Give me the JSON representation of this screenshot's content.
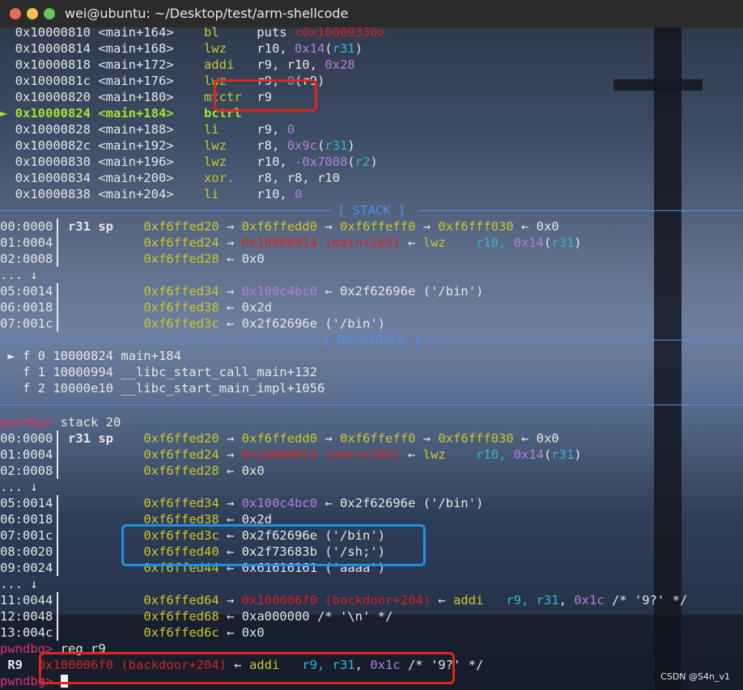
{
  "window": {
    "title": "wei@ubuntu: ~/Desktop/test/arm-shellcode"
  },
  "disasm": [
    {
      "addr": "0x10000810",
      "sym": "<main+164>",
      "op": "bl",
      "args": [
        [
          "puts ",
          "white"
        ],
        [
          "<0x10009330>",
          "red"
        ]
      ]
    },
    {
      "addr": "0x10000814",
      "sym": "<main+168>",
      "op": "lwz",
      "args": [
        [
          "r10, ",
          "white"
        ],
        [
          "0x14",
          "purple"
        ],
        [
          "(",
          "white"
        ],
        [
          "r31",
          "cyan"
        ],
        [
          ")",
          "white"
        ]
      ]
    },
    {
      "addr": "0x10000818",
      "sym": "<main+172>",
      "op": "addi",
      "args": [
        [
          "r9, r10, ",
          "white"
        ],
        [
          "0x28",
          "purple"
        ]
      ]
    },
    {
      "addr": "0x1000081c",
      "sym": "<main+176>",
      "op": "lwz",
      "args": [
        [
          "r9, ",
          "white"
        ],
        [
          "0",
          "purple"
        ],
        [
          "(r9)",
          "white"
        ]
      ]
    },
    {
      "addr": "0x10000820",
      "sym": "<main+180>",
      "op": "mtctr",
      "args": [
        [
          "r9",
          "white"
        ]
      ]
    },
    {
      "addr": "0x10000824",
      "sym": "<main+184>",
      "op": "bctrl",
      "args": [],
      "current": true
    },
    {
      "addr": "0x10000828",
      "sym": "<main+188>",
      "op": "li",
      "args": [
        [
          "r9, ",
          "white"
        ],
        [
          "0",
          "purple"
        ]
      ]
    },
    {
      "addr": "0x1000082c",
      "sym": "<main+192>",
      "op": "lwz",
      "args": [
        [
          "r8, ",
          "white"
        ],
        [
          "0x9c",
          "purple"
        ],
        [
          "(",
          "white"
        ],
        [
          "r31",
          "cyan"
        ],
        [
          ")",
          "white"
        ]
      ]
    },
    {
      "addr": "0x10000830",
      "sym": "<main+196>",
      "op": "lwz",
      "args": [
        [
          "r10, ",
          "white"
        ],
        [
          "-0x7008",
          "purple"
        ],
        [
          "(",
          "white"
        ],
        [
          "r2",
          "cyan"
        ],
        [
          ")",
          "white"
        ]
      ]
    },
    {
      "addr": "0x10000834",
      "sym": "<main+200>",
      "op": "xor.",
      "args": [
        [
          "r8, r8, r10",
          "white"
        ]
      ]
    },
    {
      "addr": "0x10000838",
      "sym": "<main+204>",
      "op": "li",
      "args": [
        [
          "r10, ",
          "white"
        ],
        [
          "0",
          "purple"
        ]
      ]
    }
  ],
  "current_marker": "►",
  "sections": {
    "stack": "[ STACK ]",
    "backtrace": "[ BACKTRACE ]"
  },
  "stack1": [
    {
      "off": "00:0000",
      "reg": "r31 sp",
      "parts": [
        [
          "0xf6ffed20",
          "yellow"
        ],
        [
          " → ",
          "white"
        ],
        [
          "0xf6ffedd0",
          "yellow"
        ],
        [
          " → ",
          "white"
        ],
        [
          "0xf6ffeff0",
          "yellow"
        ],
        [
          " → ",
          "white"
        ],
        [
          "0xf6fff030",
          "yellow"
        ],
        [
          " ← 0x0",
          "white"
        ]
      ]
    },
    {
      "off": "01:0004",
      "reg": "",
      "parts": [
        [
          "0xf6ffed24",
          "yellow"
        ],
        [
          " → ",
          "white"
        ],
        [
          "0x10000814 (main+168)",
          "red"
        ],
        [
          " ← ",
          "white"
        ],
        [
          "lwz",
          "yellow"
        ],
        [
          "    r10, ",
          "cyan"
        ],
        [
          "0x14",
          "purple"
        ],
        [
          "(",
          "white"
        ],
        [
          "r31",
          "cyan"
        ],
        [
          ")",
          "white"
        ]
      ]
    },
    {
      "off": "02:0008",
      "reg": "",
      "parts": [
        [
          "0xf6ffed28",
          "yellow"
        ],
        [
          " ← 0x0",
          "white"
        ]
      ]
    },
    {
      "off": "... ↓",
      "reg": "",
      "parts": [],
      "ellipsis": true
    },
    {
      "off": "05:0014",
      "reg": "",
      "parts": [
        [
          "0xf6ffed34",
          "yellow"
        ],
        [
          " → ",
          "white"
        ],
        [
          "0x100c4bc0",
          "purple"
        ],
        [
          " ← 0x2f62696e ('/bin')",
          "white"
        ]
      ]
    },
    {
      "off": "06:0018",
      "reg": "",
      "parts": [
        [
          "0xf6ffed38",
          "yellow"
        ],
        [
          " ← 0x2d",
          "white"
        ]
      ]
    },
    {
      "off": "07:001c",
      "reg": "",
      "parts": [
        [
          "0xf6ffed3c",
          "yellow"
        ],
        [
          " ← 0x2f62696e ('/bin')",
          "white"
        ]
      ]
    }
  ],
  "backtrace": [
    {
      "marker": "►",
      "frame": "f 0 10000824 main+184"
    },
    {
      "marker": " ",
      "frame": "f 1 10000994 __libc_start_call_main+132"
    },
    {
      "marker": " ",
      "frame": "f 2 10000e10 __libc_start_main_impl+1056"
    }
  ],
  "prompt": "pwndbg>",
  "cmd1": " stack 20",
  "stack2": [
    {
      "off": "00:0000",
      "reg": "r31 sp",
      "parts": [
        [
          "0xf6ffed20",
          "yellow"
        ],
        [
          " → ",
          "white"
        ],
        [
          "0xf6ffedd0",
          "yellow"
        ],
        [
          " → ",
          "white"
        ],
        [
          "0xf6ffeff0",
          "yellow"
        ],
        [
          " → ",
          "white"
        ],
        [
          "0xf6fff030",
          "yellow"
        ],
        [
          " ← 0x0",
          "white"
        ]
      ]
    },
    {
      "off": "01:0004",
      "reg": "",
      "parts": [
        [
          "0xf6ffed24",
          "yellow"
        ],
        [
          " → ",
          "white"
        ],
        [
          "0x10000814 (main+168)",
          "red"
        ],
        [
          " ← ",
          "white"
        ],
        [
          "lwz",
          "yellow"
        ],
        [
          "    r10, ",
          "cyan"
        ],
        [
          "0x14",
          "purple"
        ],
        [
          "(",
          "white"
        ],
        [
          "r31",
          "cyan"
        ],
        [
          ")",
          "white"
        ]
      ]
    },
    {
      "off": "02:0008",
      "reg": "",
      "parts": [
        [
          "0xf6ffed28",
          "yellow"
        ],
        [
          " ← 0x0",
          "white"
        ]
      ]
    },
    {
      "off": "... ↓",
      "reg": "",
      "parts": [],
      "ellipsis": true
    },
    {
      "off": "05:0014",
      "reg": "",
      "parts": [
        [
          "0xf6ffed34",
          "yellow"
        ],
        [
          " → ",
          "white"
        ],
        [
          "0x100c4bc0",
          "purple"
        ],
        [
          " ← 0x2f62696e ('/bin')",
          "white"
        ]
      ]
    },
    {
      "off": "06:0018",
      "reg": "",
      "parts": [
        [
          "0xf6ffed38",
          "yellow"
        ],
        [
          " ← 0x2d",
          "white"
        ]
      ]
    },
    {
      "off": "07:001c",
      "reg": "",
      "parts": [
        [
          "0xf6ffed3c",
          "yellow"
        ],
        [
          " ← 0x2f62696e ('/bin')",
          "white"
        ]
      ]
    },
    {
      "off": "08:0020",
      "reg": "",
      "parts": [
        [
          "0xf6ffed40",
          "yellow"
        ],
        [
          " ← 0x2f73683b ('/sh;')",
          "white"
        ]
      ]
    },
    {
      "off": "09:0024",
      "reg": "",
      "parts": [
        [
          "0xf6ffed44",
          "yellow"
        ],
        [
          " ← 0x61616161 ('aaaa')",
          "white"
        ]
      ]
    },
    {
      "off": "... ↓",
      "reg": "",
      "parts": [],
      "ellipsis": true
    },
    {
      "off": "11:0044",
      "reg": "",
      "parts": [
        [
          "0xf6ffed64",
          "yellow"
        ],
        [
          " → ",
          "white"
        ],
        [
          "0x100006f0 (backdoor+204)",
          "red"
        ],
        [
          " ← ",
          "white"
        ],
        [
          "addi",
          "yellow"
        ],
        [
          "   r9, ",
          "cyan"
        ],
        [
          "r31",
          "cyan"
        ],
        [
          ", ",
          "white"
        ],
        [
          "0x1c",
          "purple"
        ],
        [
          " /* '9?' */",
          "white"
        ]
      ]
    },
    {
      "off": "12:0048",
      "reg": "",
      "parts": [
        [
          "0xf6ffed68",
          "yellow"
        ],
        [
          " ← 0xa000000 /* '\\n' */",
          "white"
        ]
      ]
    },
    {
      "off": "13:004c",
      "reg": "",
      "parts": [
        [
          "0xf6ffed6c",
          "yellow"
        ],
        [
          " ← 0x0",
          "white"
        ]
      ]
    }
  ],
  "cmd2": " reg r9",
  "reg_line": {
    "name": "R9",
    "parts": [
      [
        "0x100006f0 (backdoor+204)",
        "red"
      ],
      [
        " ← ",
        "white"
      ],
      [
        "addi",
        "yellow"
      ],
      [
        "   r9, ",
        "cyan"
      ],
      [
        "r31",
        "cyan"
      ],
      [
        ", ",
        "white"
      ],
      [
        "0x1c",
        "purple"
      ],
      [
        " /* '9?' */",
        "white"
      ]
    ]
  },
  "watermark": "CSDN @S4n_v1"
}
